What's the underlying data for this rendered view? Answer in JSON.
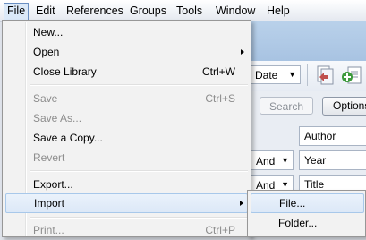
{
  "menubar": {
    "items": [
      "File",
      "Edit",
      "References",
      "Groups",
      "Tools",
      "Window",
      "Help"
    ]
  },
  "background": {
    "sort_value": "Date",
    "search_label": "Search",
    "options_label": "Options",
    "fields": [
      "Author",
      "Year",
      "Title"
    ],
    "operators": [
      "And",
      "And"
    ]
  },
  "file_menu": {
    "new": "New...",
    "open": "Open",
    "close_library": "Close Library",
    "close_library_shortcut": "Ctrl+W",
    "save": "Save",
    "save_shortcut": "Ctrl+S",
    "save_as": "Save As...",
    "save_copy": "Save a Copy...",
    "revert": "Revert",
    "export": "Export...",
    "import": "Import",
    "print": "Print...",
    "print_shortcut": "Ctrl+P"
  },
  "import_submenu": {
    "file": "File...",
    "folder": "Folder..."
  },
  "colors": {
    "menu_background": "#f2f2f2",
    "highlight": "#dce8f7",
    "highlight_border": "#a8c8ea",
    "disabled_text": "#8d8d8d"
  }
}
